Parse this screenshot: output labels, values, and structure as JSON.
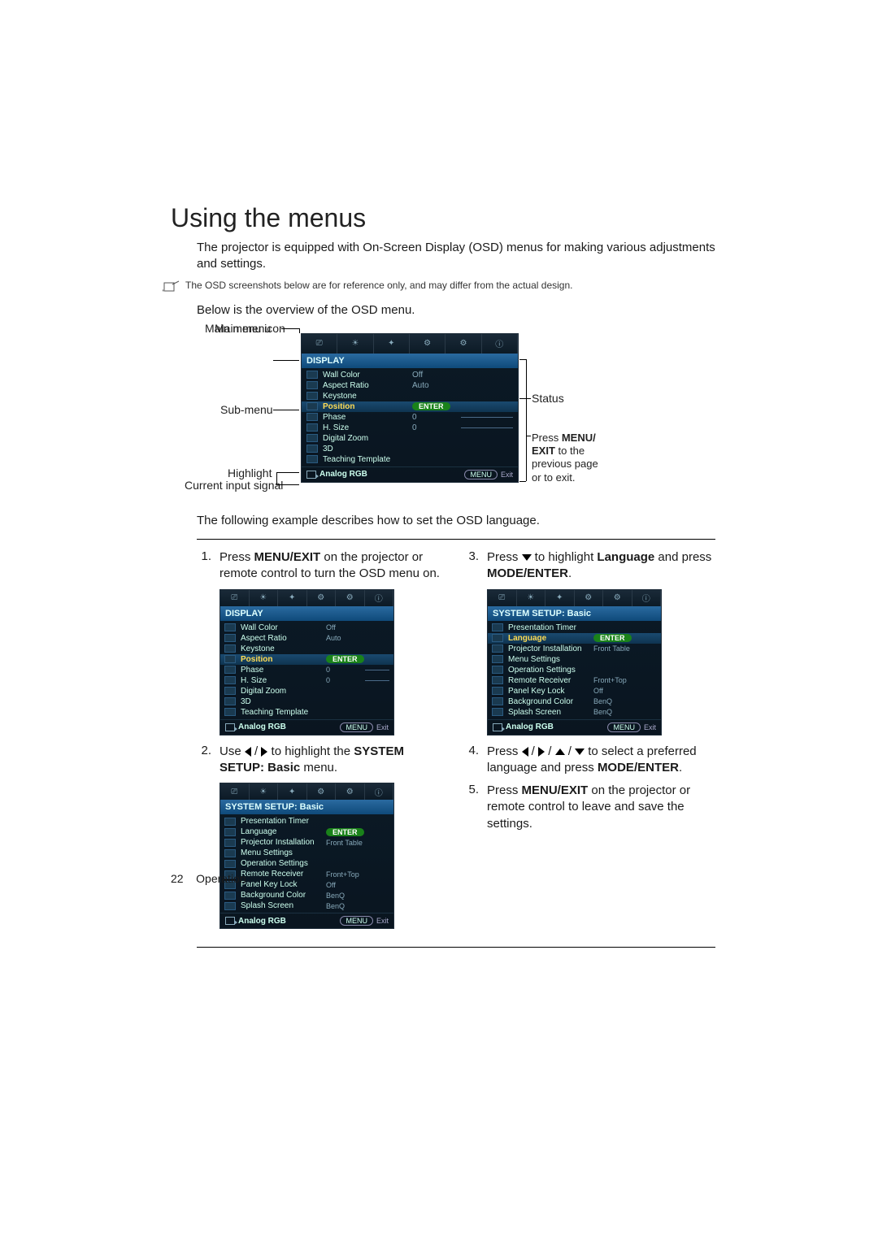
{
  "heading": "Using the menus",
  "intro": "The projector is equipped with On-Screen Display (OSD) menus for making various adjustments and settings.",
  "note": "The OSD screenshots below are for reference only, and may differ from the actual design.",
  "overview_intro": "Below is the overview of the OSD menu.",
  "labels": {
    "main_icon": "Main menu icon",
    "main_menu": "Main menu",
    "sub_menu": "Sub-menu",
    "highlight": "Highlight",
    "current_input": "Current input signal",
    "status": "Status",
    "press_menu": "Press MENU/ EXIT to the previous page or to exit."
  },
  "osd_display": {
    "title": "DISPLAY",
    "items": [
      {
        "label": "Wall Color",
        "val": "Off"
      },
      {
        "label": "Aspect Ratio",
        "val": "Auto"
      },
      {
        "label": "Keystone",
        "val": ""
      },
      {
        "label": "Position",
        "val": "",
        "hl": true,
        "enter": true
      },
      {
        "label": "Phase",
        "val": "0",
        "slider": true
      },
      {
        "label": "H. Size",
        "val": "0",
        "slider": true
      },
      {
        "label": "Digital Zoom",
        "val": ""
      },
      {
        "label": "3D",
        "val": ""
      },
      {
        "label": "Teaching Template",
        "val": ""
      }
    ],
    "input": "Analog RGB",
    "footer": [
      "MENU",
      "Exit"
    ]
  },
  "osd_system": {
    "title": "SYSTEM SETUP: Basic",
    "items": [
      {
        "label": "Presentation Timer",
        "val": ""
      },
      {
        "label": "Language",
        "val": "",
        "enter": true
      },
      {
        "label": "Projector Installation",
        "val": "Front Table"
      },
      {
        "label": "Menu Settings",
        "val": ""
      },
      {
        "label": "Operation Settings",
        "val": ""
      },
      {
        "label": "Remote Receiver",
        "val": "Front+Top"
      },
      {
        "label": "Panel Key Lock",
        "val": "Off"
      },
      {
        "label": "Background Color",
        "val": "BenQ"
      },
      {
        "label": "Splash Screen",
        "val": "BenQ"
      }
    ],
    "input": "Analog RGB",
    "footer": [
      "MENU",
      "Exit"
    ]
  },
  "osd_system_lang": {
    "title": "SYSTEM SETUP: Basic",
    "items": [
      {
        "label": "Presentation Timer",
        "val": ""
      },
      {
        "label": "Language",
        "val": "",
        "hl": true,
        "enter": true
      },
      {
        "label": "Projector Installation",
        "val": "Front Table"
      },
      {
        "label": "Menu Settings",
        "val": ""
      },
      {
        "label": "Operation Settings",
        "val": ""
      },
      {
        "label": "Remote Receiver",
        "val": "Front+Top"
      },
      {
        "label": "Panel Key Lock",
        "val": "Off"
      },
      {
        "label": "Background Color",
        "val": "BenQ"
      },
      {
        "label": "Splash Screen",
        "val": "BenQ"
      }
    ],
    "input": "Analog RGB",
    "footer": [
      "MENU",
      "Exit"
    ]
  },
  "example_intro": "The following example describes how to set the OSD language.",
  "steps": {
    "s1_a": "Press ",
    "s1_b": "MENU/EXIT",
    "s1_c": " on the projector or remote control to turn the OSD menu on.",
    "s2_a": "Use ",
    "s2_b": " to highlight the ",
    "s2_c": "SYSTEM SETUP: Basic",
    "s2_d": " menu.",
    "s3_a": "Press ",
    "s3_b": " to highlight ",
    "s3_c": "Language",
    "s3_d": " and press ",
    "s3_e": "MODE/ENTER",
    "s3_f": ".",
    "s4_a": "Press ",
    "s4_b": " to select a preferred language and press ",
    "s4_c": "MODE/ENTER",
    "s4_d": ".",
    "s5_a": "Press ",
    "s5_b": "MENU/EXIT",
    "s5_c": " on the projector or remote control to leave and save the settings."
  },
  "page_footer": {
    "num": "22",
    "section": "Operation"
  }
}
